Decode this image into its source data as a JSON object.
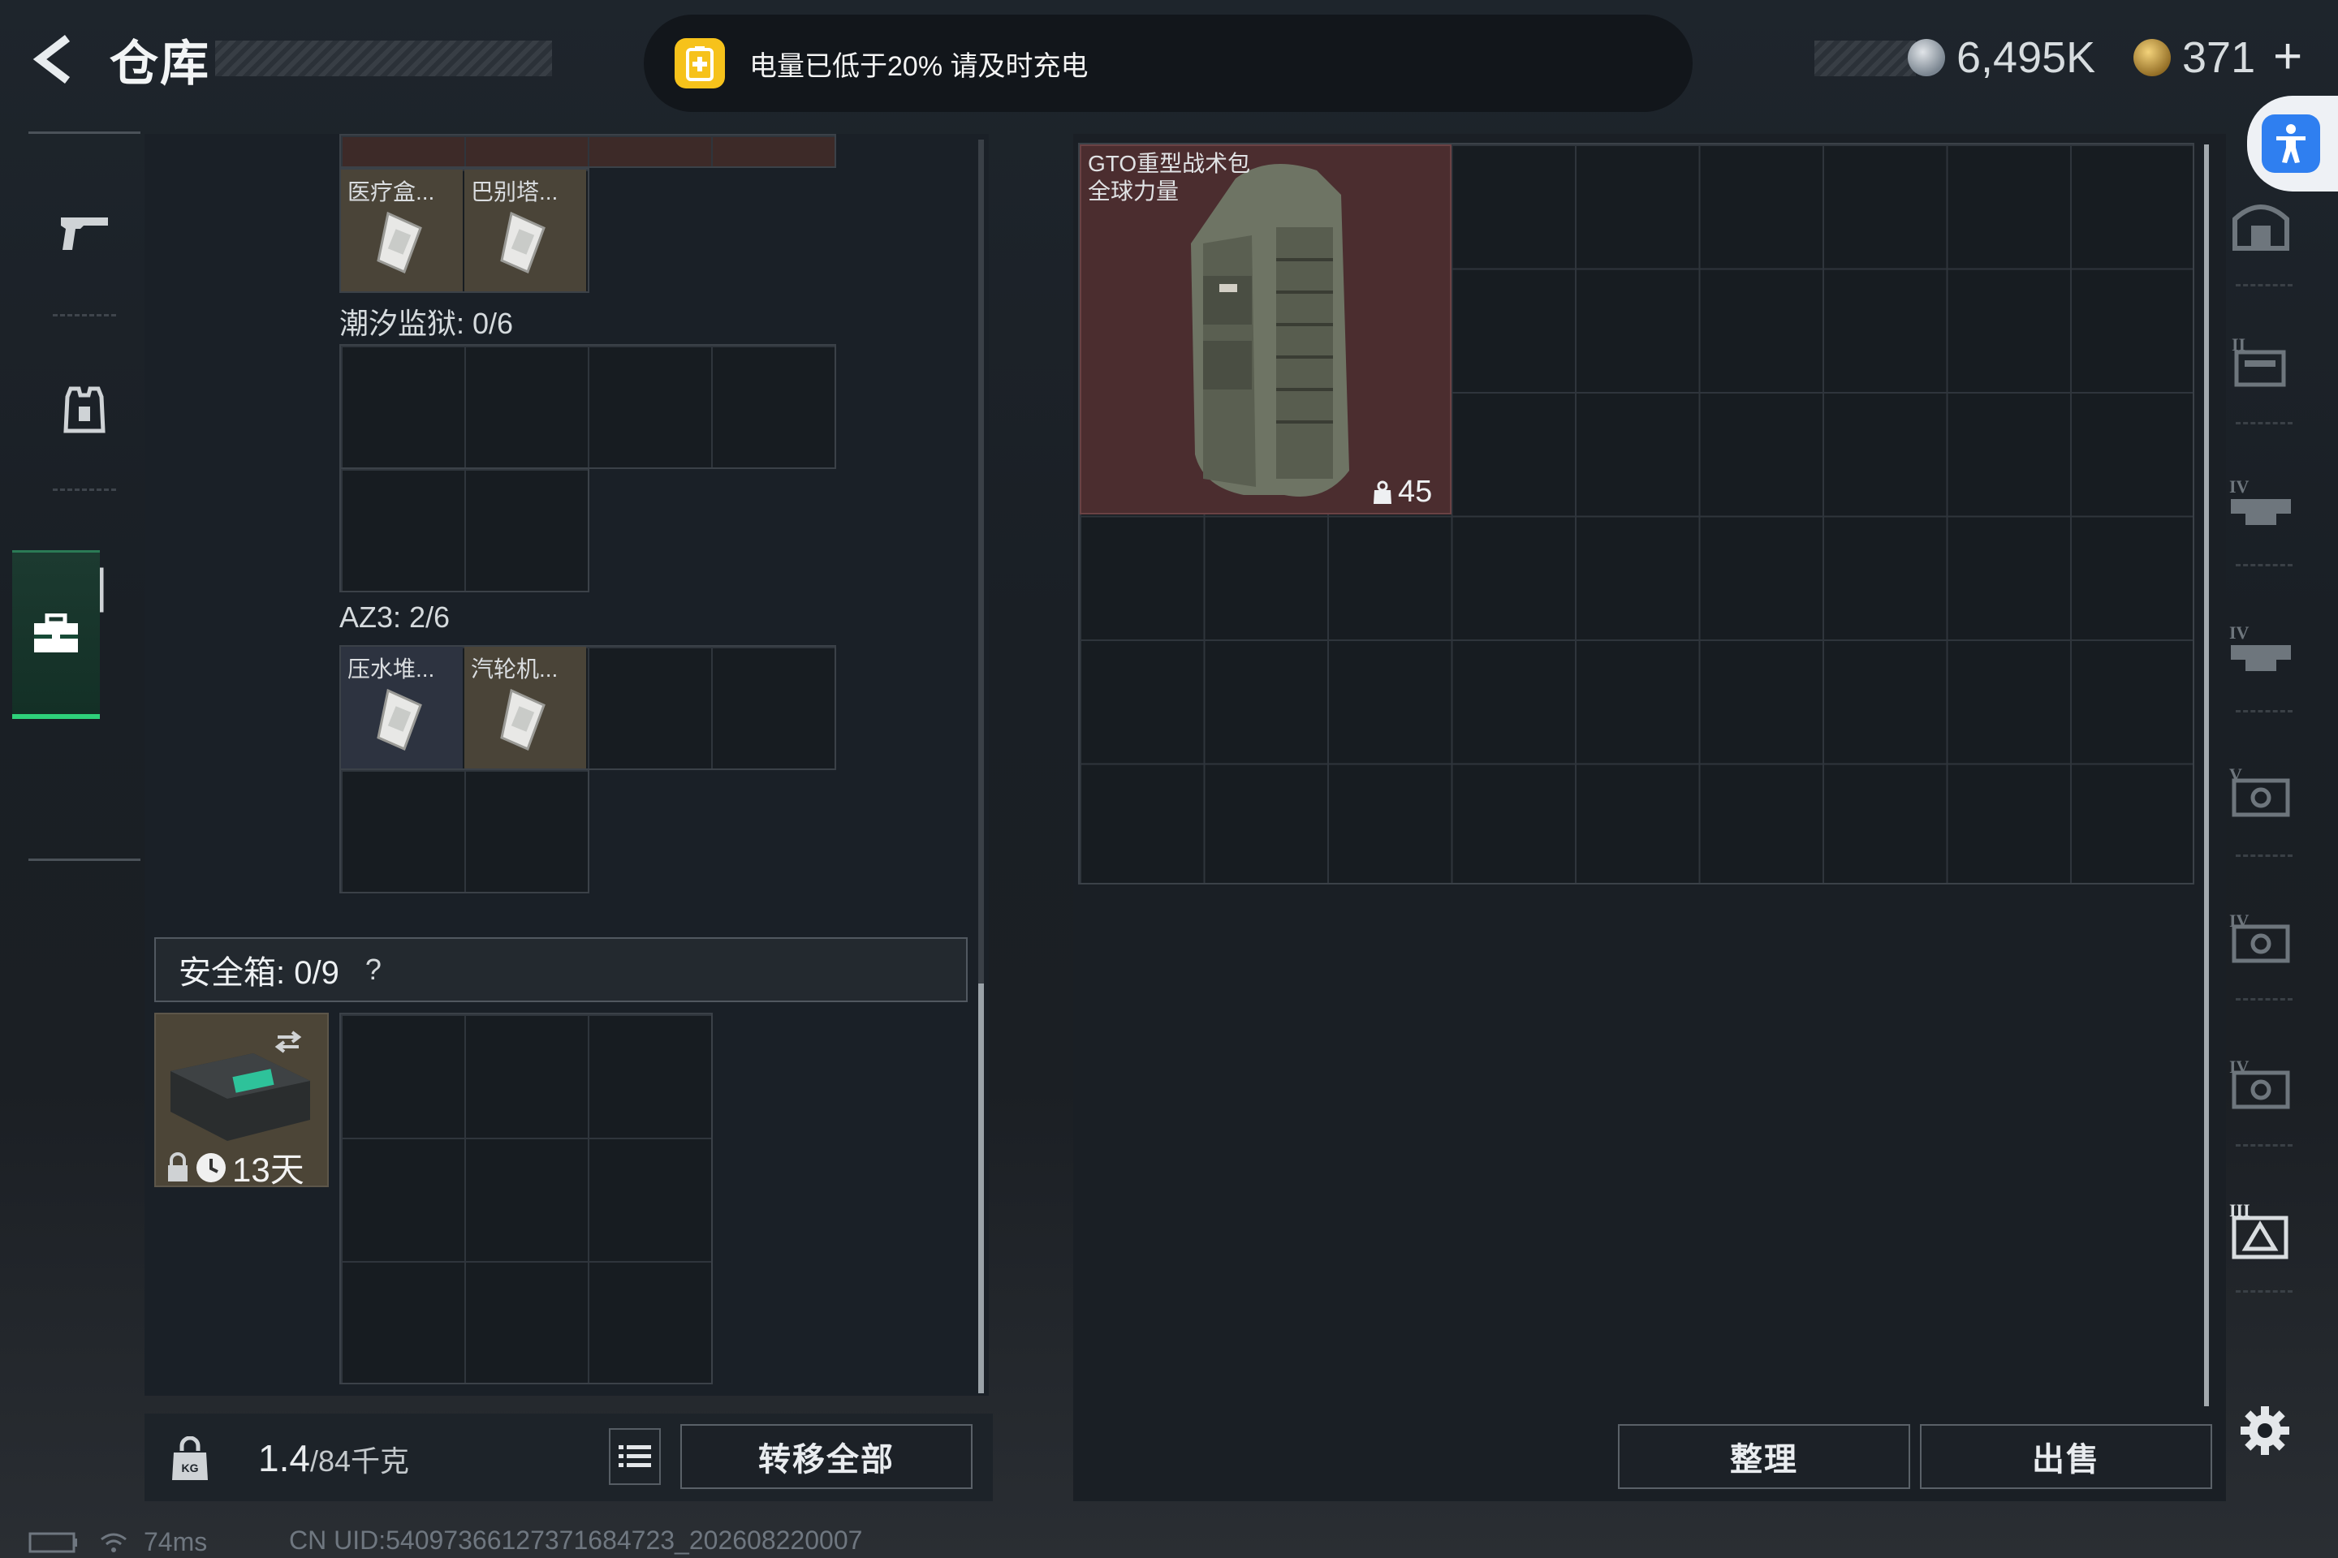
{
  "header": {
    "title": "仓库",
    "battery_warning": "电量已低于20%  请及时充电",
    "currency_silver": "6,495K",
    "currency_gold": "371",
    "plus_label": "+"
  },
  "left_panel": {
    "top_items": [
      {
        "name": "医疗盒..."
      },
      {
        "name": "巴别塔..."
      }
    ],
    "sections": [
      {
        "label": "潮汐监狱: 0/6"
      },
      {
        "label": "AZ3: 2/6",
        "items": [
          {
            "name": "压水堆..."
          },
          {
            "name": "汽轮机..."
          }
        ]
      }
    ],
    "safebox": {
      "label": "安全箱:  0/9",
      "help": "?",
      "timer": "13天"
    },
    "weight_current": "1.4",
    "weight_capacity": "/84千克",
    "transfer_all": "转移全部"
  },
  "stash": {
    "backpack_name": "GTO重型战术包",
    "backpack_sub": "全球力量",
    "backpack_count": "45",
    "sort_label": "整理",
    "sell_label": "出售"
  },
  "status": {
    "ping": "74ms",
    "uid": "CN UID:54097366127371684723_202608220007"
  },
  "colors": {
    "accent_green": "#2ed17a",
    "battery_yellow": "#f6c21b",
    "accessibility_blue": "#2f7ff0",
    "backpack_red": "#4b2d2f"
  }
}
